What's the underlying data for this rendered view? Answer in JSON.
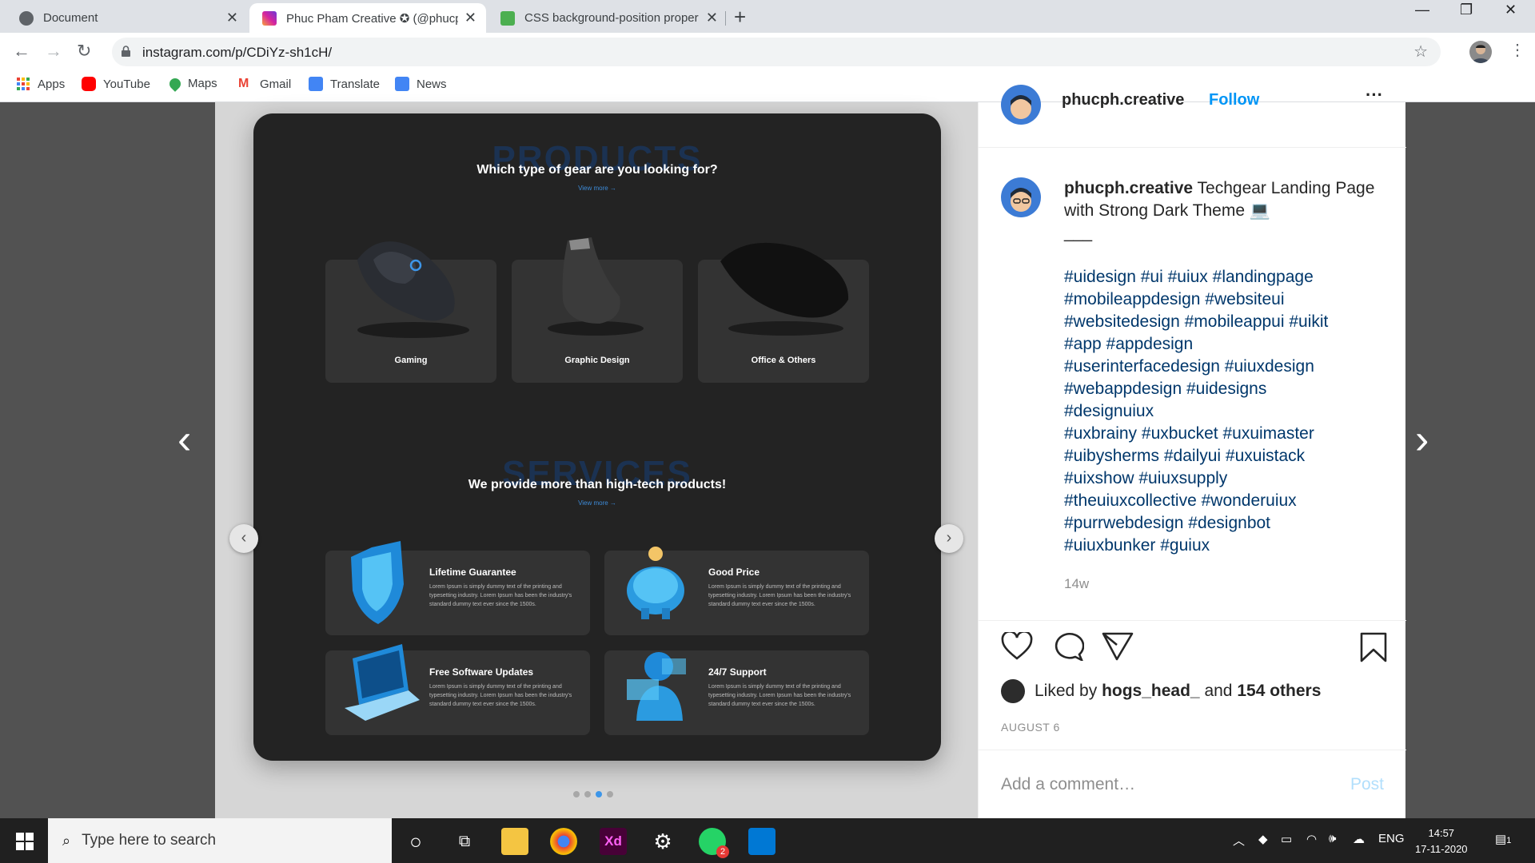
{
  "browser": {
    "tabs": [
      {
        "title": "Document",
        "active": false
      },
      {
        "title": "Phuc Pham Creative ✪ (@phucph",
        "active": true
      },
      {
        "title": "CSS background-position proper",
        "active": false
      }
    ],
    "url": "instagram.com/p/CDiYz-sh1cH/",
    "bookmarks": [
      "Apps",
      "YouTube",
      "Maps",
      "Gmail",
      "Translate",
      "News"
    ]
  },
  "post_image": {
    "products_watermark": "PRODUCTS",
    "products_heading": "Which type of gear are you looking for?",
    "view_more": "View more →",
    "products": [
      "Gaming",
      "Graphic Design",
      "Office & Others"
    ],
    "services_watermark": "SERVICES",
    "services_heading": "We provide more than high-tech products!",
    "services": [
      {
        "title": "Lifetime Guarantee",
        "desc": "Lorem Ipsum is simply dummy text of the printing and typesetting industry. Lorem Ipsum has been the industry's standard dummy text ever since the 1500s."
      },
      {
        "title": "Good Price",
        "desc": "Lorem Ipsum is simply dummy text of the printing and typesetting industry. Lorem Ipsum has been the industry's standard dummy text ever since the 1500s."
      },
      {
        "title": "Free Software Updates",
        "desc": "Lorem Ipsum is simply dummy text of the printing and typesetting industry. Lorem Ipsum has been the industry's standard dummy text ever since the 1500s."
      },
      {
        "title": "24/7 Support",
        "desc": "Lorem Ipsum is simply dummy text of the printing and typesetting industry. Lorem Ipsum has been the industry's standard dummy text ever since the 1500s."
      }
    ],
    "accent": "#3d96e9"
  },
  "post": {
    "username": "phucph.creative",
    "follow": "Follow",
    "caption": "Techgear Landing Page with Strong Dark Theme 💻",
    "divider": "___",
    "hashtags": [
      "#uidesign #ui #uiux #landingpage",
      "#mobileappdesign #websiteui",
      "#websitedesign #mobileappui #uikit",
      "#app #appdesign",
      "#userinterfacedesign #uiuxdesign",
      "#webappdesign #uidesigns",
      "#designuiux",
      "#uxbrainy #uxbucket #uxuimaster",
      "#uibysherms #dailyui #uxuistack",
      "#uixshow #uiuxsupply",
      "#theuiuxcollective #wonderuiux",
      "#purrwebdesign #designbot",
      "#uiuxbunker #guiux"
    ],
    "age": "14w",
    "liked_prefix": "Liked by",
    "liked_user": "hogs_head_",
    "liked_and": "and",
    "liked_others": "154 others",
    "date": "AUGUST 6",
    "comment_placeholder": "Add a comment…",
    "post_button": "Post"
  },
  "taskbar": {
    "search_placeholder": "Type here to search",
    "lang": "ENG",
    "time": "14:57",
    "date": "17-11-2020",
    "whatsapp_badge": "2",
    "notif_count": "1"
  }
}
